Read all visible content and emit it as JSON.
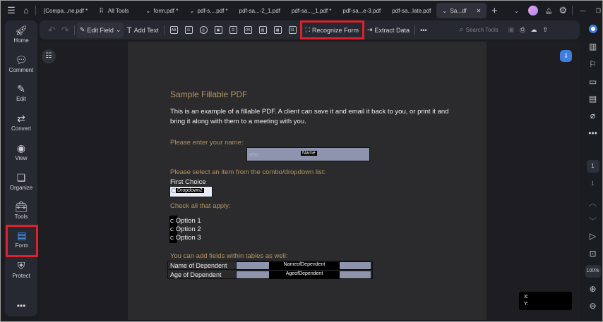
{
  "tabs": {
    "items": [
      "[Compa...ne.pdf *",
      "All Tools",
      "form.pdf *",
      "pdf-s....pdf *",
      "pdf-sa...-2_1.pdf",
      "pdf-sa..._1.pdf *",
      "pdf-sa...e-3.pdf",
      "pdf-sa...late.pdf",
      "Sa...df"
    ]
  },
  "toolbar": {
    "edit_field": "Edit Field",
    "add_text": "Add Text",
    "recognize_form": "Recognize Form",
    "extract_data": "Extract Data",
    "search_tools": "Search Tools",
    "icons": [
      "AB",
      "☑",
      "◎",
      "▣",
      "☰",
      "OK",
      "▨",
      "▦",
      "31"
    ]
  },
  "sidebar": {
    "items": [
      {
        "label": "Home",
        "icon": "rocket"
      },
      {
        "label": "Comment",
        "icon": "comment"
      },
      {
        "label": "Edit",
        "icon": "edit"
      },
      {
        "label": "Convert",
        "icon": "convert"
      },
      {
        "label": "View",
        "icon": "eye"
      },
      {
        "label": "Organize",
        "icon": "organize"
      },
      {
        "label": "Tools",
        "icon": "toolbox"
      },
      {
        "label": "Form",
        "icon": "form"
      },
      {
        "label": "Protect",
        "icon": "shield"
      }
    ]
  },
  "doc": {
    "title": "Sample Fillable PDF",
    "intro1": "This is an example of a fillable PDF. A client can save it and email it back to you, or print it and",
    "intro2": "bring it along with them to a meeting with you.",
    "name_label": "Please enter your name:",
    "name_placeholder": "abc",
    "name_field": "Name",
    "combo_label": "Please select an item from the combo/dropdown list:",
    "first_choice": "First Choice",
    "dropdown_c": "C",
    "dropdown_field": "Dropdown2",
    "check_label": "Check all that apply:",
    "options": [
      "Option 1",
      "Option 2",
      "Option 3"
    ],
    "check_c": "C",
    "table_label": "You can add  fields within tables as well:",
    "row1": "Name of Dependent",
    "row1_field": "NameofDependent",
    "row2": "Age of Dependent",
    "row2_field": "AgeofDependent"
  },
  "rightbar": {
    "page_current": "1",
    "page_total": "1",
    "zoom": "100%"
  },
  "coords": {
    "x": "X:",
    "y": "Y:"
  },
  "colors": {
    "accent_red": "#e0202a",
    "heading_gold": "#b49360",
    "field_fill": "#8e94ae"
  }
}
